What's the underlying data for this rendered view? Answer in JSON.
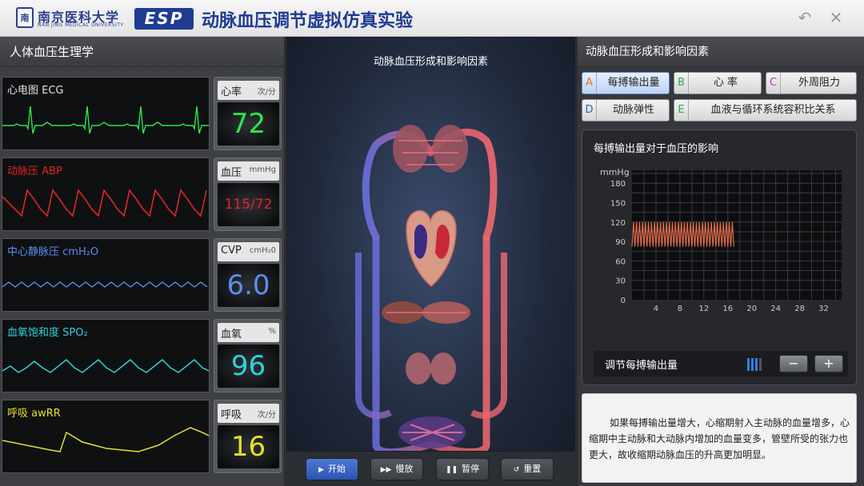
{
  "header": {
    "uni_logo_char": "南",
    "uni_name": "南京医科大学",
    "uni_en": "NAN JING MEDICAL UNIVERSITY",
    "esp": "ESP",
    "title": "动脉血压调节虚拟仿真实验",
    "undo_icon": "undo-icon",
    "close_icon": "close-icon"
  },
  "left": {
    "title": "人体血压生理学",
    "vitals": [
      {
        "label": "心电图 ECG",
        "name": "心率",
        "unit": "次/分",
        "value": "72",
        "color": "#2ee64a"
      },
      {
        "label": "动脉压 ABP",
        "name": "血压",
        "unit": "mmHg",
        "value": "115/72",
        "color": "#e02424"
      },
      {
        "label": "中心静脉压 cmH₂O",
        "name": "CVP",
        "unit": "cmH₂0",
        "value": "6.0",
        "color": "#5b8ef0"
      },
      {
        "label": "血氧饱和度 SPO₂",
        "name": "血氧",
        "unit": "%",
        "value": "96",
        "color": "#2fd3d6"
      },
      {
        "label": "呼吸 awRR",
        "name": "呼吸",
        "unit": "次/分",
        "value": "16",
        "color": "#e8df2a"
      }
    ]
  },
  "center": {
    "title": "动脉血压形成和影响因素",
    "controls": [
      {
        "icon": "▶",
        "label": "开始",
        "active": true
      },
      {
        "icon": "▶▶",
        "label": "慢放",
        "active": false
      },
      {
        "icon": "❚❚",
        "label": "暂停",
        "active": false
      },
      {
        "icon": "↺",
        "label": "重置",
        "active": false
      }
    ]
  },
  "right": {
    "title": "动脉血压形成和影响因素",
    "tabs": [
      {
        "letter": "A",
        "label": "每搏输出量",
        "color": "#e07a1f"
      },
      {
        "letter": "B",
        "label": "心 率",
        "color": "#2fa84f"
      },
      {
        "letter": "C",
        "label": "外周阻力",
        "color": "#b23ab8"
      },
      {
        "letter": "D",
        "label": "动脉弹性",
        "color": "#2c62c7"
      },
      {
        "letter": "E",
        "label": "血液与循环系统容积比关系",
        "color": "#2fa84f"
      }
    ],
    "graph_title": "每搏输出量对于血压的影响",
    "adjust_label": "调节每搏输出量",
    "minus": "−",
    "plus": "+",
    "level": 3,
    "description": "如果每搏输出量增大，心缩期射入主动脉的血量增多，心缩期中主动脉和大动脉内增加的血量变多，管壁所受的张力也更大，故收缩期动脉血压的升高更加明显。"
  },
  "chart_data": {
    "type": "line",
    "ylabel": "mmHg",
    "yticks": [
      0,
      30,
      60,
      90,
      120,
      150,
      180
    ],
    "xticks": [
      4,
      8,
      12,
      16,
      20,
      24,
      28,
      32
    ],
    "ylim": [
      0,
      200
    ],
    "xlim": [
      0,
      35
    ],
    "grid": true,
    "series": [
      {
        "x_start": 0,
        "x_end": 17,
        "systolic": 120,
        "diastolic": 82,
        "cycles": 34,
        "color": "#e06a4a"
      }
    ]
  }
}
